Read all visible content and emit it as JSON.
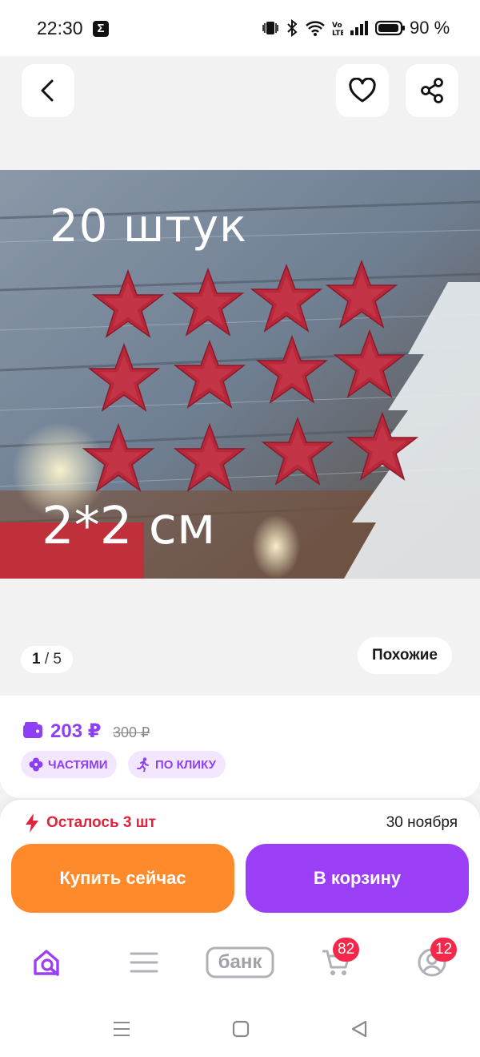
{
  "status_bar": {
    "time": "22:30",
    "battery_percent": "90 %"
  },
  "header": {
    "icons": [
      "back-arrow-icon",
      "heart-icon",
      "share-icon"
    ]
  },
  "product_image": {
    "overlay_top_text": "20 штук",
    "overlay_bottom_text": "2*2 см",
    "star_color": "#b8283a"
  },
  "gallery": {
    "current_index": "1",
    "total_text": "/ 5",
    "similar_label": "Похожие"
  },
  "price": {
    "current": "203 ₽",
    "old": "300 ₽",
    "chips": [
      "ЧАСТЯМИ",
      "ПО КЛИКУ"
    ]
  },
  "purchase": {
    "stock_text": "Осталось 3 шт",
    "delivery_date": "30 ноября",
    "buy_now_label": "Купить сейчас",
    "add_to_cart_label": "В корзину"
  },
  "tab_bar": {
    "bank_label": "банк",
    "cart_badge": "82",
    "profile_badge": "12"
  },
  "colors": {
    "accent_purple": "#9b3ff6",
    "buy_orange": "#ff8a2b",
    "alert_red": "#e0233a"
  }
}
